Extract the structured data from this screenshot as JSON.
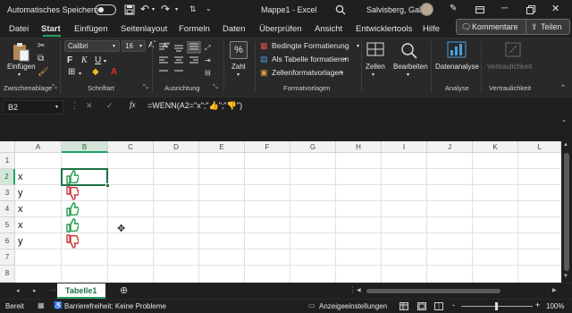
{
  "titlebar": {
    "autosave_label": "Automatisches Speichern",
    "doc_title": "Mappe1 - Excel",
    "user_name": "Salvisberg, Gaby"
  },
  "ribbon_tabs": [
    "Datei",
    "Start",
    "Einfügen",
    "Seitenlayout",
    "Formeln",
    "Daten",
    "Überprüfen",
    "Ansicht",
    "Entwicklertools",
    "Hilfe"
  ],
  "comments_button": "Kommentare",
  "share_button": "Teilen",
  "ribbon": {
    "paste_label": "Einfügen",
    "font_name": "Calibri",
    "font_size": "16",
    "bold": "F",
    "italic": "K",
    "underline": "U",
    "number_label": "Zahl",
    "cond_format": "Bedingte Formatierung",
    "as_table": "Als Tabelle formatieren",
    "cell_styles": "Zellenformatvorlagen",
    "cells_label": "Zellen",
    "edit_label": "Bearbeiten",
    "data_analysis": "Datenanalyse",
    "sensitivity": "Vertraulichkeit",
    "groups": {
      "clipboard": "Zwischenablage",
      "font": "Schriftart",
      "alignment": "Ausrichtung",
      "number": "Zahl",
      "styles": "Formatvorlagen",
      "analysis": "Analyse",
      "sensitivity": "Vertraulichkeit"
    }
  },
  "formula_bar": {
    "name_box": "B2",
    "fx": "fx",
    "formula": "=WENN(A2=\"x\";\"👍\";\"👎\")"
  },
  "grid": {
    "columns": [
      "A",
      "B",
      "C",
      "D",
      "E",
      "F",
      "G",
      "H",
      "I",
      "J",
      "K",
      "L"
    ],
    "rows": [
      "1",
      "2",
      "3",
      "4",
      "5",
      "6",
      "7",
      "8"
    ],
    "col_a_values": [
      "",
      "x",
      "y",
      "x",
      "x",
      "y",
      "",
      ""
    ],
    "col_b_icons": [
      "",
      "thumbs-up",
      "thumbs-down",
      "thumbs-up",
      "thumbs-up",
      "thumbs-down",
      "",
      ""
    ],
    "selected_cell": "B2",
    "colors": {
      "thumb_up": "#1e9e4a",
      "thumb_down": "#d13438",
      "accent": "#21a366"
    }
  },
  "sheet": {
    "tab_name": "Tabelle1"
  },
  "status": {
    "mode": "Bereit",
    "accessibility": "Barrierefreiheit: Keine Probleme",
    "display_settings": "Anzeigeeinstellungen",
    "zoom_minus": "-",
    "zoom_plus": "+",
    "zoom": "100%"
  }
}
